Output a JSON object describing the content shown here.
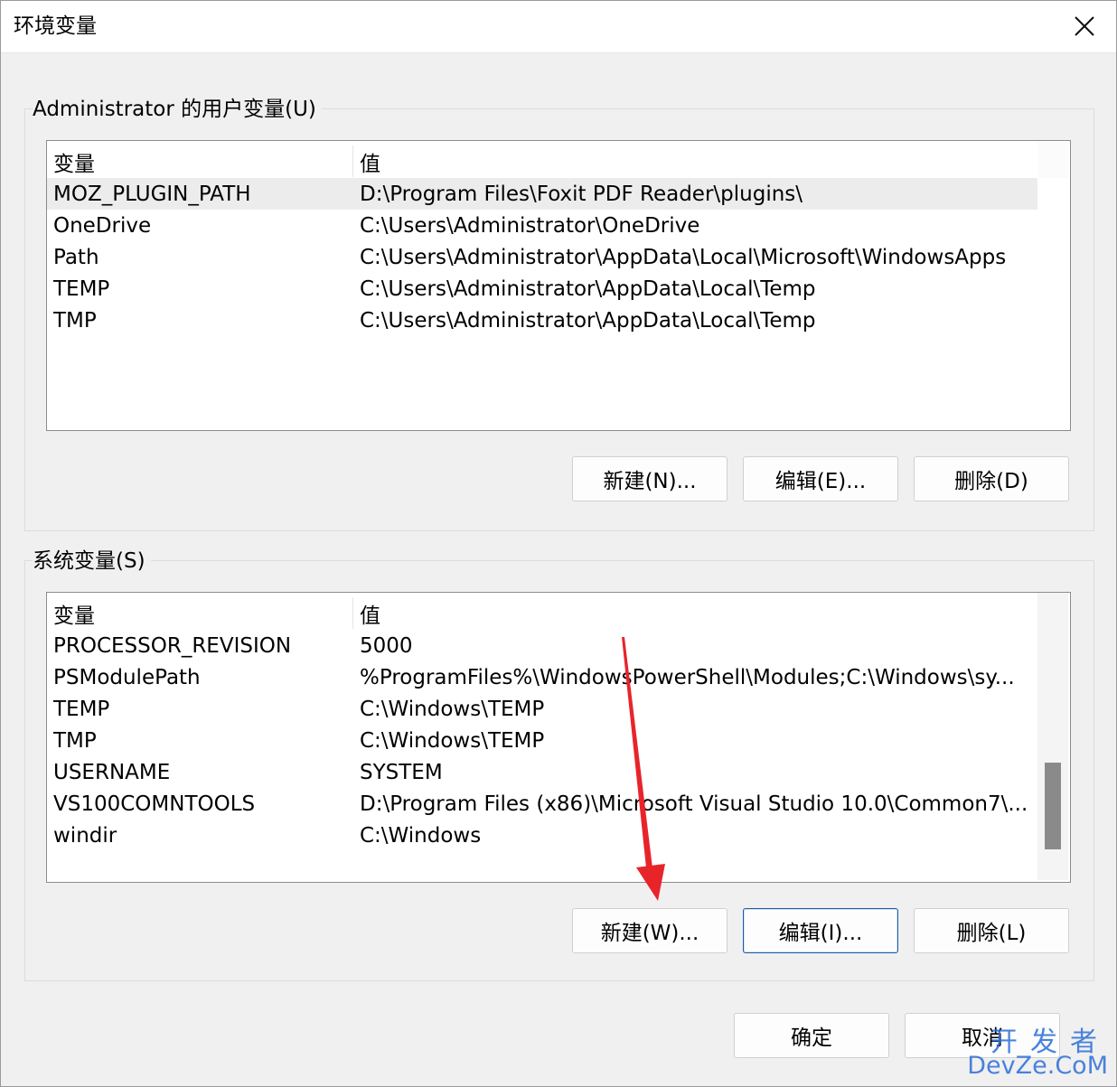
{
  "window": {
    "title": "环境变量"
  },
  "user_vars": {
    "group_label": "Administrator 的用户变量(U)",
    "header": {
      "variable": "变量",
      "value": "值"
    },
    "rows": [
      {
        "variable": "MOZ_PLUGIN_PATH",
        "value": "D:\\Program Files\\Foxit PDF Reader\\plugins\\"
      },
      {
        "variable": "OneDrive",
        "value": "C:\\Users\\Administrator\\OneDrive"
      },
      {
        "variable": "Path",
        "value": "C:\\Users\\Administrator\\AppData\\Local\\Microsoft\\WindowsApps"
      },
      {
        "variable": "TEMP",
        "value": "C:\\Users\\Administrator\\AppData\\Local\\Temp"
      },
      {
        "variable": "TMP",
        "value": "C:\\Users\\Administrator\\AppData\\Local\\Temp"
      }
    ],
    "buttons": {
      "new": "新建(N)...",
      "edit": "编辑(E)...",
      "delete": "删除(D)"
    }
  },
  "system_vars": {
    "group_label": "系统变量(S)",
    "header": {
      "variable": "变量",
      "value": "值"
    },
    "rows": [
      {
        "variable": "PROCESSOR_REVISION",
        "value": "5000"
      },
      {
        "variable": "PSModulePath",
        "value": "%ProgramFiles%\\WindowsPowerShell\\Modules;C:\\Windows\\sy..."
      },
      {
        "variable": "TEMP",
        "value": "C:\\Windows\\TEMP"
      },
      {
        "variable": "TMP",
        "value": "C:\\Windows\\TEMP"
      },
      {
        "variable": "USERNAME",
        "value": "SYSTEM"
      },
      {
        "variable": "VS100COMNTOOLS",
        "value": "D:\\Program Files (x86)\\Microsoft Visual Studio 10.0\\Common7\\..."
      },
      {
        "variable": "windir",
        "value": "C:\\Windows"
      }
    ],
    "buttons": {
      "new": "新建(W)...",
      "edit": "编辑(I)...",
      "delete": "删除(L)"
    }
  },
  "footer": {
    "ok": "确定",
    "cancel": "取消"
  },
  "watermark": {
    "top": "开发者",
    "bottom": "DevZe.CoM"
  },
  "colors": {
    "annotation_arrow": "#e8242b",
    "focus_border": "#1f5c9e",
    "watermark": "#2d6ed8"
  }
}
